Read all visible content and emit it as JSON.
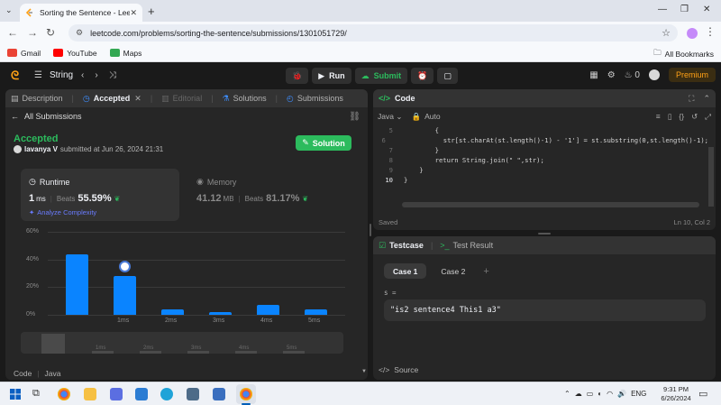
{
  "browser": {
    "tab_title": "Sorting the Sentence - LeetCode",
    "url": "leetcode.com/problems/sorting-the-sentence/submissions/1301051729/",
    "bookmarks": [
      {
        "label": "Gmail",
        "color": "#ea4335"
      },
      {
        "label": "YouTube",
        "color": "#ff0000"
      },
      {
        "label": "Maps",
        "color": "#34a853"
      }
    ],
    "all_bookmarks": "All Bookmarks"
  },
  "nav": {
    "list_label": "String",
    "run_label": "Run",
    "submit_label": "Submit",
    "streak": "0",
    "premium": "Premium"
  },
  "left": {
    "tabs": [
      {
        "label": "Description",
        "active": false
      },
      {
        "label": "Accepted",
        "active": true
      },
      {
        "label": "Editorial",
        "active": false
      },
      {
        "label": "Solutions",
        "active": false
      },
      {
        "label": "Submissions",
        "active": false
      }
    ],
    "all_submissions": "All Submissions",
    "status": "Accepted",
    "user": "lavanya V",
    "submitted_at": "submitted at Jun 26, 2024 21:31",
    "solution_btn": "Solution",
    "runtime": {
      "title": "Runtime",
      "value": "1",
      "unit": "ms",
      "beats_label": "Beats",
      "beats": "55.59%",
      "analyze": "Analyze Complexity"
    },
    "memory": {
      "title": "Memory",
      "value": "41.12",
      "unit": "MB",
      "beats_label": "Beats",
      "beats": "81.17%"
    },
    "language_label": "Code",
    "language": "Java"
  },
  "chart_data": {
    "type": "bar",
    "categories": [
      "0ms",
      "1ms",
      "2ms",
      "3ms",
      "4ms",
      "5ms"
    ],
    "tick_labels": [
      "",
      "1ms",
      "2ms",
      "3ms",
      "4ms",
      "5ms"
    ],
    "values": [
      44,
      28,
      4,
      2,
      7,
      4
    ],
    "yticks": [
      "0%",
      "20%",
      "40%",
      "60%"
    ],
    "ylim": [
      0,
      60
    ],
    "highlight_category": "1ms",
    "bar_color": "#0a84ff",
    "scrubber_labels": [
      "1ms",
      "2ms",
      "3ms",
      "4ms",
      "5ms"
    ]
  },
  "code": {
    "title": "Code",
    "language": "Java",
    "mode": "Auto",
    "lines": [
      {
        "n": "5",
        "text": "        {"
      },
      {
        "n": "6",
        "text": "            str[st.charAt(st.length()-1) - '1'] = st.substring(0,st.length()-1);"
      },
      {
        "n": "7",
        "text": "        }"
      },
      {
        "n": "8",
        "text": "        return String.join(\" \",str);"
      },
      {
        "n": "9",
        "text": "    }"
      },
      {
        "n": "10",
        "text": "}"
      }
    ],
    "saved": "Saved",
    "cursor": "Ln 10, Col 2"
  },
  "test": {
    "tab_testcase": "Testcase",
    "tab_result": "Test Result",
    "cases": [
      "Case 1",
      "Case 2"
    ],
    "var_label": "s =",
    "input_value": "\"is2 sentence4 This1 a3\"",
    "source": "Source"
  },
  "taskbar": {
    "lang": "ENG",
    "time": "9:31 PM",
    "date": "6/26/2024"
  }
}
